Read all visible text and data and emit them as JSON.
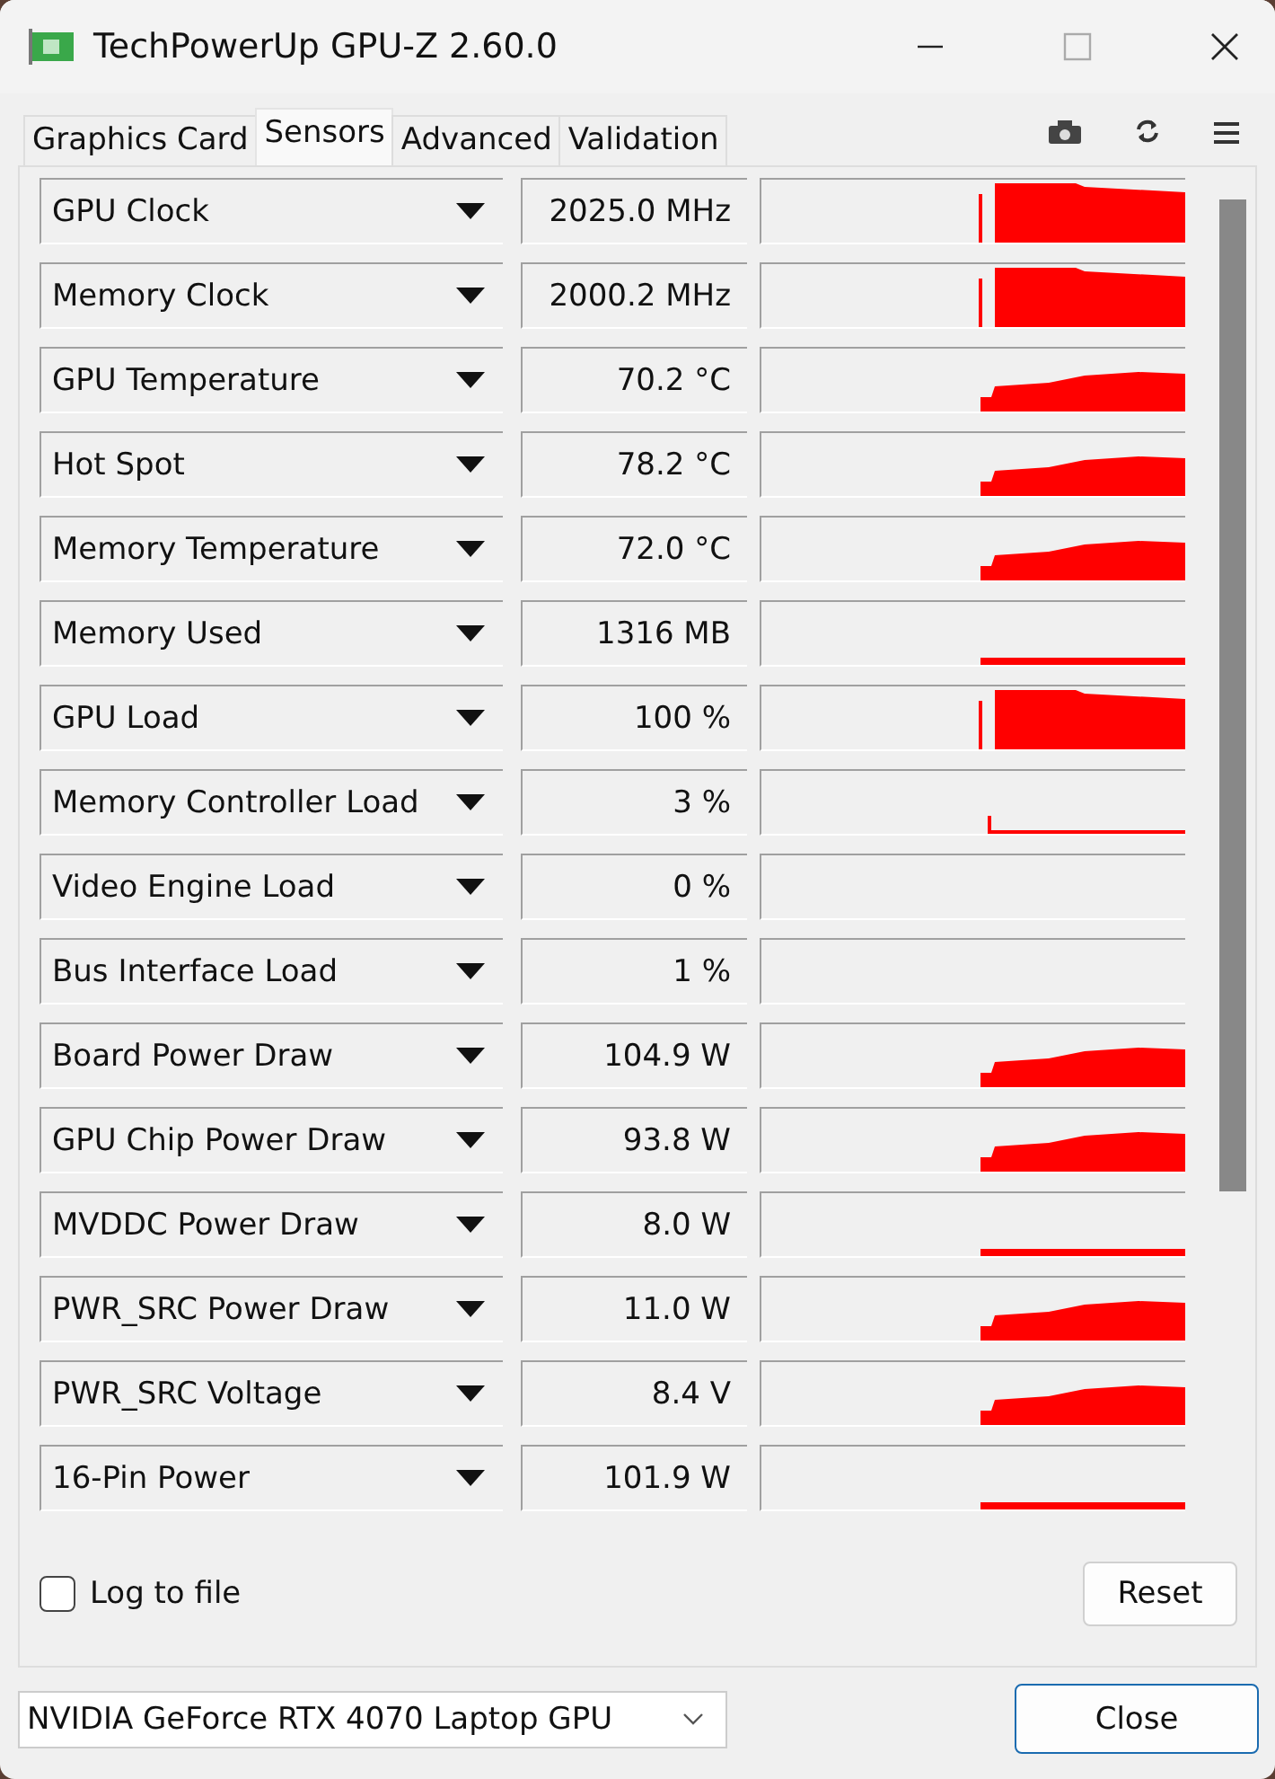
{
  "window": {
    "title": "TechPowerUp GPU-Z 2.60.0"
  },
  "tabs": [
    {
      "label": "Graphics Card",
      "selected": false
    },
    {
      "label": "Sensors",
      "selected": true
    },
    {
      "label": "Advanced",
      "selected": false
    },
    {
      "label": "Validation",
      "selected": false
    }
  ],
  "sensors": [
    {
      "name": "GPU Clock",
      "value": "2025.0 MHz"
    },
    {
      "name": "Memory Clock",
      "value": "2000.2 MHz"
    },
    {
      "name": "GPU Temperature",
      "value": "70.2 °C"
    },
    {
      "name": "Hot Spot",
      "value": "78.2 °C"
    },
    {
      "name": "Memory Temperature",
      "value": "72.0 °C"
    },
    {
      "name": "Memory Used",
      "value": "1316 MB"
    },
    {
      "name": "GPU Load",
      "value": "100 %"
    },
    {
      "name": "Memory Controller Load",
      "value": "3 %"
    },
    {
      "name": "Video Engine Load",
      "value": "0 %"
    },
    {
      "name": "Bus Interface Load",
      "value": "1 %"
    },
    {
      "name": "Board Power Draw",
      "value": "104.9 W"
    },
    {
      "name": "GPU Chip Power Draw",
      "value": "93.8 W"
    },
    {
      "name": "MVDDC Power Draw",
      "value": "8.0 W"
    },
    {
      "name": "PWR_SRC Power Draw",
      "value": "11.0 W"
    },
    {
      "name": "PWR_SRC Voltage",
      "value": "8.4 V"
    },
    {
      "name": "16-Pin Power",
      "value": "101.9 W"
    }
  ],
  "log_to_file": {
    "label": "Log to file",
    "checked": false
  },
  "reset_button": "Reset",
  "gpu_select": {
    "value": "NVIDIA GeForce RTX 4070 Laptop GPU"
  },
  "close_button": "Close"
}
